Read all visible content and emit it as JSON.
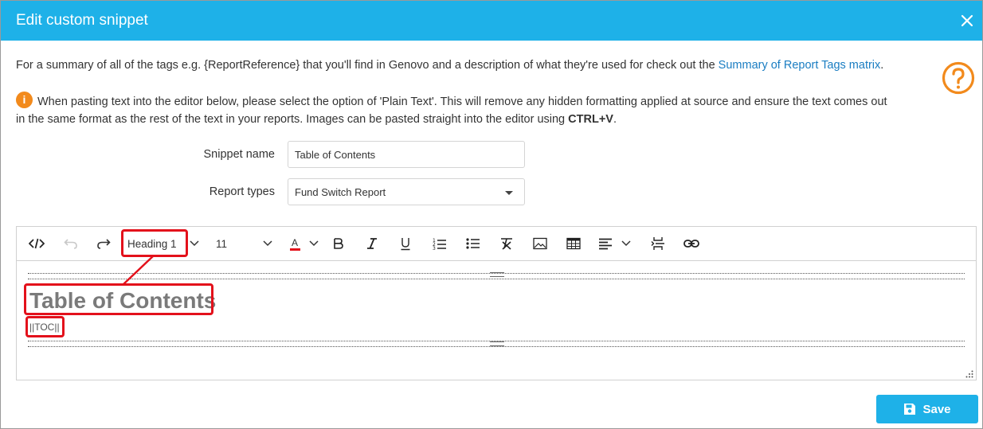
{
  "dialog": {
    "title": "Edit custom snippet"
  },
  "info": {
    "summary_prefix": "For a summary of all of the tags e.g. {ReportReference} that you'll find in Genovo and a description of what they're used for check out the ",
    "summary_link": "Summary of Report Tags matrix",
    "summary_suffix": ".",
    "paste_text_line1": "When pasting text into the editor below, please select the option of 'Plain Text'. This will remove any hidden formatting applied at source and ensure the text comes out",
    "paste_text_line2_prefix": "in the same format as the rest of the text in your reports. Images can be pasted straight into the editor using ",
    "paste_text_shortcut": "CTRL+V",
    "paste_text_suffix": "."
  },
  "form": {
    "snippet_name_label": "Snippet name",
    "snippet_name_value": "Table of Contents",
    "report_types_label": "Report types",
    "report_types_value": "Fund Switch Report"
  },
  "toolbar": {
    "block_format": "Heading 1",
    "font_size": "11",
    "font_color_letter": "A",
    "font_color": "#e3111b"
  },
  "editor": {
    "heading": "Table of Contents",
    "toc_tag": "||TOC||"
  },
  "footer": {
    "save_label": "Save"
  },
  "colors": {
    "header": "#1eb1e8",
    "link": "#1a7dc2",
    "help_icon": "#f28a1c",
    "highlight": "#e3111b"
  }
}
